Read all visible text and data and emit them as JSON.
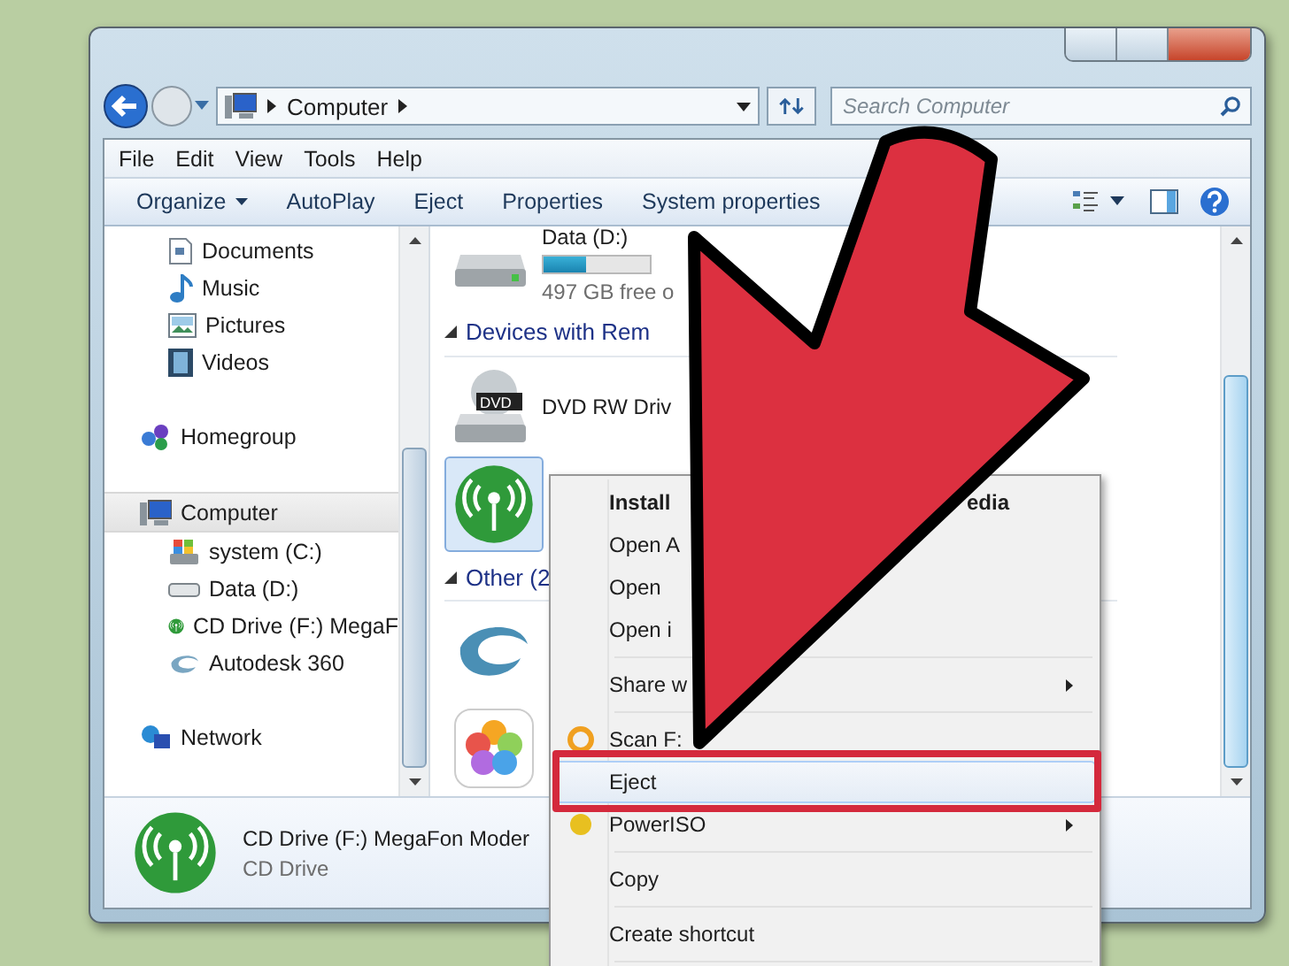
{
  "address_bar": {
    "path": "Computer"
  },
  "search": {
    "placeholder": "Search Computer"
  },
  "menu_bar": [
    "File",
    "Edit",
    "View",
    "Tools",
    "Help"
  ],
  "command_bar": [
    {
      "label": "Organize",
      "dropdown": true
    },
    {
      "label": "AutoPlay",
      "dropdown": false
    },
    {
      "label": "Eject",
      "dropdown": false
    },
    {
      "label": "Properties",
      "dropdown": false
    },
    {
      "label": "System properties",
      "dropdown": false
    }
  ],
  "nav": {
    "groups": [
      {
        "children": [
          {
            "label": "Documents",
            "kind": "documents"
          },
          {
            "label": "Music",
            "kind": "music"
          },
          {
            "label": "Pictures",
            "kind": "pictures"
          },
          {
            "label": "Videos",
            "kind": "videos"
          }
        ]
      },
      {
        "label": "Homegroup",
        "kind": "homegroup",
        "selected": false
      },
      {
        "label": "Computer",
        "kind": "computer",
        "selected": true,
        "children": [
          {
            "label": "system (C:)",
            "kind": "system"
          },
          {
            "label": "Data (D:)",
            "kind": "drive"
          },
          {
            "label": "CD Drive (F:) MegaF",
            "kind": "modem"
          },
          {
            "label": "Autodesk 360",
            "kind": "autodesk"
          }
        ]
      },
      {
        "label": "Network",
        "kind": "network",
        "selected": false
      }
    ]
  },
  "content": {
    "sections": [
      {
        "items": [
          {
            "kind": "drive",
            "name": "Data (D:)",
            "level": 0.4,
            "info": "497 GB free o",
            "selected": false
          }
        ]
      },
      {
        "title": "Devices with Rem",
        "expanded": true,
        "items": [
          {
            "kind": "dvd",
            "badge": "DVD",
            "name": "DVD RW Driv",
            "selected": false
          },
          {
            "kind": "modem",
            "selected": true
          }
        ]
      },
      {
        "title": "Other (2",
        "expanded": true,
        "items": [
          {
            "kind": "autodesk",
            "selected": false
          },
          {
            "kind": "photos",
            "selected": false
          }
        ]
      }
    ]
  },
  "details": {
    "name": "CD Drive (F:) MegaFon Moder",
    "type": "CD Drive"
  },
  "context_menu": {
    "items": [
      {
        "kind": "item",
        "label": "Install",
        "label_end": "edia",
        "default": true,
        "submenu": false,
        "selected": false
      },
      {
        "kind": "item",
        "label": "Open A",
        "default": false,
        "submenu": false,
        "selected": false
      },
      {
        "kind": "item",
        "label": "Open",
        "default": false,
        "submenu": false,
        "selected": false
      },
      {
        "kind": "item",
        "label": "Open i",
        "default": false,
        "submenu": false,
        "selected": false
      },
      {
        "kind": "separator"
      },
      {
        "kind": "item",
        "label": "Share w",
        "default": false,
        "submenu": true,
        "selected": false
      },
      {
        "kind": "separator"
      },
      {
        "kind": "scan",
        "label": "Scan F:",
        "default": false,
        "submenu": false,
        "selected": false
      },
      {
        "kind": "item",
        "label": "Eject",
        "default": false,
        "submenu": false,
        "selected": true
      },
      {
        "kind": "disc-tool",
        "label": "PowerISO",
        "default": false,
        "submenu": true,
        "selected": false
      },
      {
        "kind": "separator"
      },
      {
        "kind": "item",
        "label": "Copy",
        "default": false,
        "submenu": false,
        "selected": false
      },
      {
        "kind": "separator"
      },
      {
        "kind": "item",
        "label": "Create shortcut",
        "default": false,
        "submenu": false,
        "selected": false
      },
      {
        "kind": "separator"
      }
    ]
  }
}
